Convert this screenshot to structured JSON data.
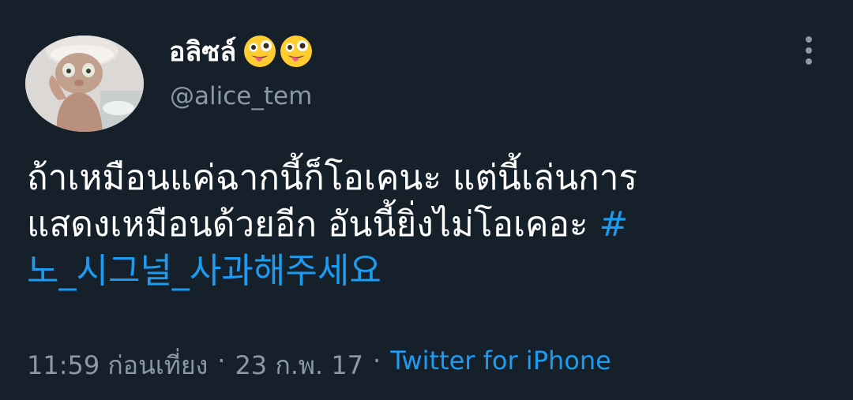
{
  "tweet": {
    "author": {
      "display_name": "อลิซล์",
      "emojis": [
        "zany-face",
        "zany-face"
      ],
      "handle": "@alice_tem"
    },
    "text_lines": [
      "ถ้าเหมือนแค่ฉากนี้ก็โอเคนะ แต่นี้เล่นการ",
      "แสดงเหมือนด้วยอีก อันนี้ยิ่งไม่โอเคอะ "
    ],
    "hashtag_start": "#",
    "hashtag_rest": "노_시그널_사과해주세요",
    "meta": {
      "time": "11:59 ก่อนเที่ยง",
      "date": "23 ก.พ. 17",
      "separator": "·",
      "source": "Twitter for iPhone"
    }
  },
  "colors": {
    "background": "#15202b",
    "text": "#ffffff",
    "secondary": "#8b98a5",
    "link": "#1d9bf0"
  }
}
